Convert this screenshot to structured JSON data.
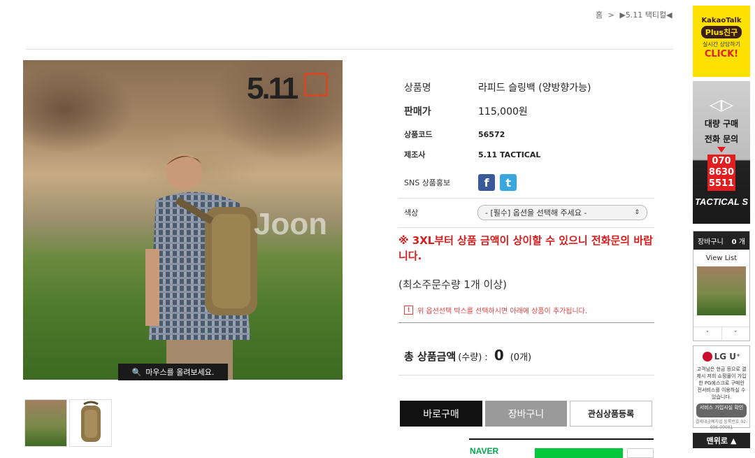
{
  "breadcrumb": {
    "home": "홈",
    "sep": ">",
    "current": "▶5.11 택티컬◀"
  },
  "photo": {
    "brand_logo": "5.11",
    "watermark": "Joon",
    "zoom_tip": "마우스를 올려보세요."
  },
  "product": {
    "rows": [
      {
        "key": "상품명",
        "value": "라피드 슬링백 (양방향가능)"
      },
      {
        "key": "판매가",
        "value": "115,000원"
      },
      {
        "key": "상품코드",
        "value": "56572"
      },
      {
        "key": "제조사",
        "value": "5.11 TACTICAL"
      }
    ],
    "sns_label": "SNS 상품홍보",
    "sns_facebook": "f",
    "sns_twitter": "t",
    "color_label": "색상",
    "color_select": "- [필수] 옵션을 선택해 주세요 -",
    "warning": "※ 3XL부터 상품 금액이 상이할 수 있으니 전화문의 바랍니다.",
    "min_qty": "(최소주문수량 1개 이상)",
    "notice": "위 옵션선택 박스를 선택하시면 아래에 상품이 추가됩니다.",
    "total_label": "총 상품금액",
    "total_qty_label": "(수량) :",
    "total_value": "0",
    "total_count": "(0개)"
  },
  "buttons": {
    "buy": "바로구매",
    "cart": "장바구니",
    "wish": "관심상품등록"
  },
  "naver": {
    "label": "NAVER"
  },
  "sidebar": {
    "kakao": {
      "title": "KakaoTalk",
      "plus": "Plus친구",
      "sub": "실시간 상담하기",
      "click": "CLICK!"
    },
    "bulk": {
      "line1": "대량 구매",
      "line2": "전화 문의",
      "phone": [
        "070",
        "8630",
        "5511"
      ],
      "brand": "TACTICAL S"
    },
    "cart": {
      "title": "장바구니",
      "count": "0",
      "unit": "개",
      "view_list": "View List",
      "up": "˄",
      "down": "˅"
    },
    "lgu": {
      "logo": "LG U⁺",
      "text": "고객님은 현금 등으로 결제시 저희 쇼핑몰이 가입한 PG에스크로 구매안전서비스를 이용하실 수 있습니다.",
      "button": "서비스 가입사실 확인 ➕",
      "small": "결제대금예치업 등록번호 02-006-00001"
    },
    "to_top": "맨위로"
  },
  "colors": {
    "accent_red": "#d81b1b",
    "naver_green": "#00c73c",
    "kakao_yellow": "#ffe100"
  }
}
